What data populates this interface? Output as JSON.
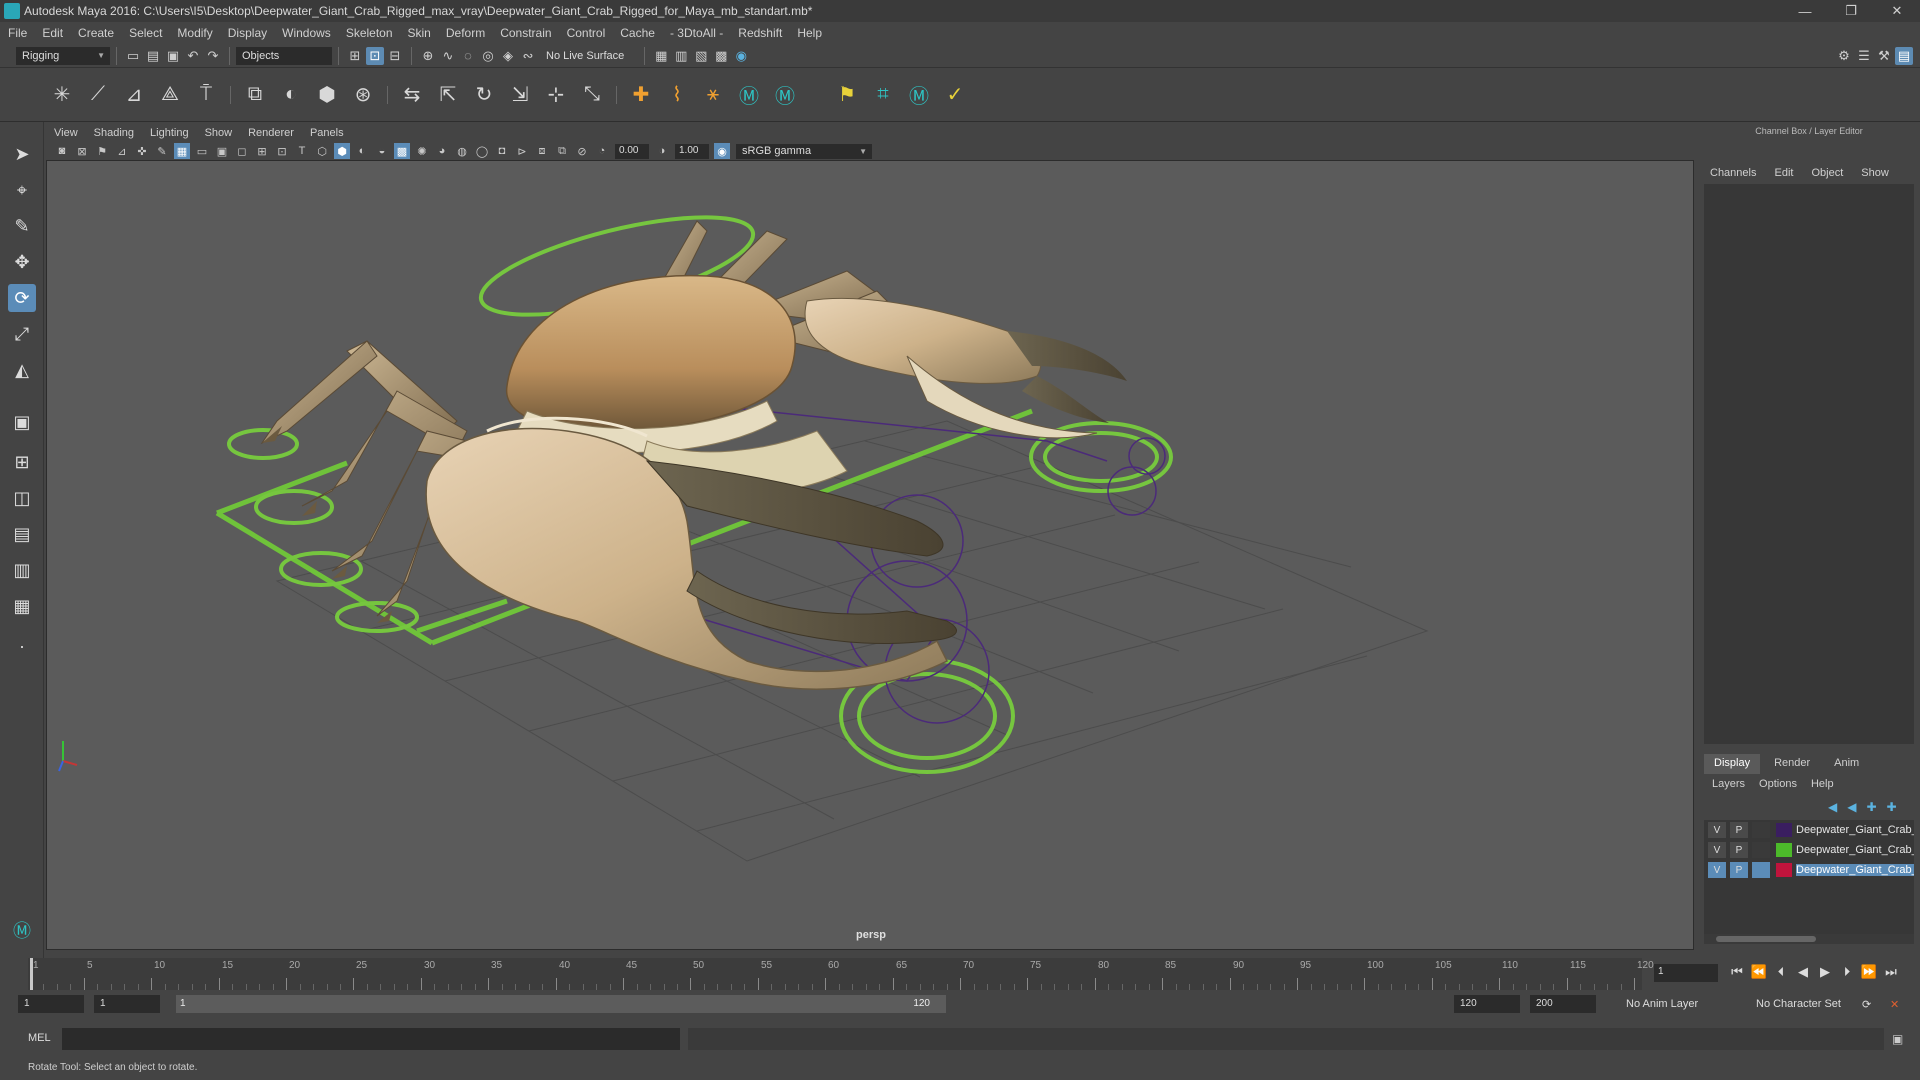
{
  "window": {
    "title": "Autodesk Maya 2016: C:\\Users\\I5\\Desktop\\Deepwater_Giant_Crab_Rigged_max_vray\\Deepwater_Giant_Crab_Rigged_for_Maya_mb_standart.mb*",
    "controls": [
      "—",
      "❐",
      "✕"
    ]
  },
  "menubar": [
    "File",
    "Edit",
    "Create",
    "Select",
    "Modify",
    "Display",
    "Windows",
    "Skeleton",
    "Skin",
    "Deform",
    "Constrain",
    "Control",
    "Cache",
    "- 3DtoAll -",
    "Redshift",
    "Help"
  ],
  "statusline": {
    "mode": "Rigging",
    "selection_mode": "Objects",
    "live_surface": "No Live Surface"
  },
  "panel": {
    "menus": [
      "View",
      "Shading",
      "Lighting",
      "Show",
      "Renderer",
      "Panels"
    ],
    "exposure": "0.00",
    "gamma": "1.00",
    "color_space": "sRGB gamma",
    "camera_label": "persp"
  },
  "channel_box": {
    "title": "Channel Box / Layer Editor",
    "menus": [
      "Channels",
      "Edit",
      "Object",
      "Show"
    ]
  },
  "layer_editor": {
    "tabs": [
      "Display",
      "Render",
      "Anim"
    ],
    "active_tab": "Display",
    "menus": [
      "Layers",
      "Options",
      "Help"
    ],
    "layers": [
      {
        "v": "V",
        "p": "P",
        "color": "#3a1e60",
        "name": "Deepwater_Giant_Crab_Helpers",
        "selected": false
      },
      {
        "v": "V",
        "p": "P",
        "color": "#4cba2a",
        "name": "Deepwater_Giant_Crab_Controllers",
        "selected": false
      },
      {
        "v": "V",
        "p": "P",
        "color": "#c0143c",
        "name": "Deepwater_Giant_Crab_Geometry",
        "selected": true
      }
    ]
  },
  "timeline": {
    "labels": [
      "1",
      "5",
      "10",
      "15",
      "20",
      "25",
      "30",
      "35",
      "40",
      "45",
      "50",
      "55",
      "60",
      "65",
      "70",
      "75",
      "80",
      "85",
      "90",
      "95",
      "100",
      "105",
      "110",
      "115",
      "120"
    ],
    "current_frame": "1"
  },
  "range": {
    "start_field": "1",
    "start_inner": "1",
    "bar_start": "1",
    "bar_end": "120",
    "end_inner": "120",
    "end_field": "200",
    "anim_layer": "No Anim Layer",
    "character_set": "No Character Set"
  },
  "command": {
    "lang": "MEL",
    "help": "Rotate Tool: Select an object to rotate."
  }
}
